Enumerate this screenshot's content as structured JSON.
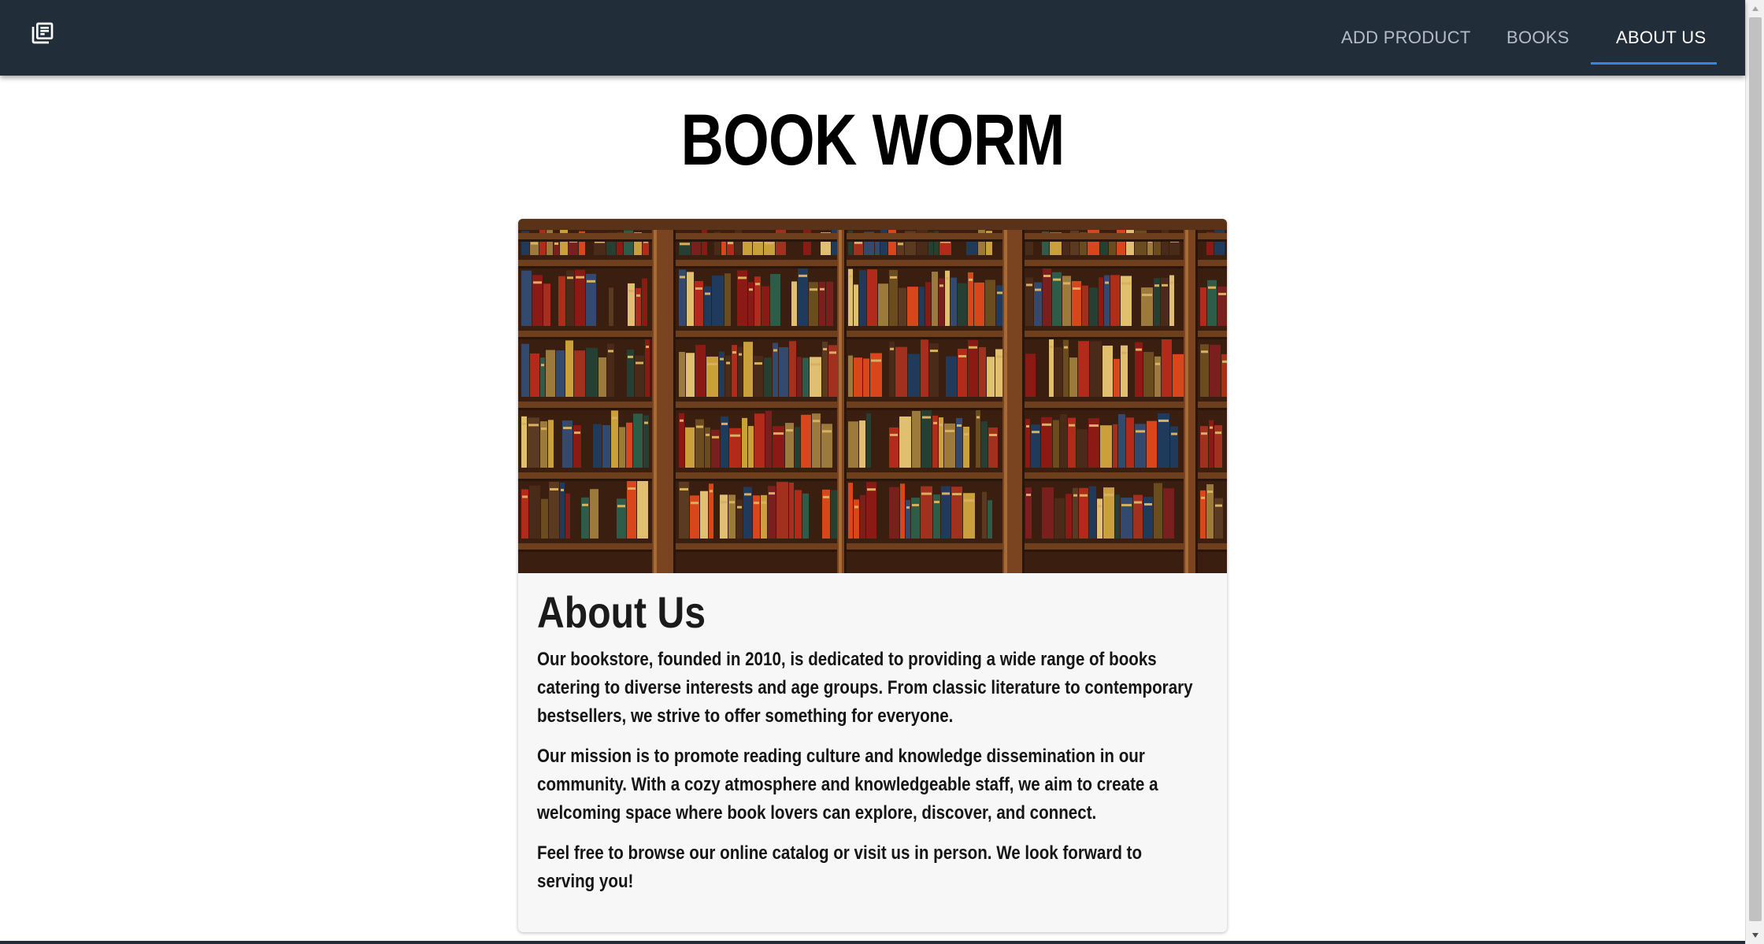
{
  "header": {
    "logo_icon": "library-books-icon",
    "nav": {
      "add_product": "ADD PRODUCT",
      "books": "BOOKS",
      "about_us": "ABOUT US"
    },
    "active_tab": "ABOUT US",
    "accent_color": "#2f86e8",
    "background_color": "#222d3a"
  },
  "page": {
    "title": "BOOK WORM"
  },
  "about_card": {
    "image": "bookshelves-photo",
    "heading": "About Us",
    "paragraphs": [
      "Our bookstore, founded in 2010, is dedicated to providing a wide range of books catering to diverse interests and age groups. From classic literature to contemporary bestsellers, we strive to offer something for everyone.",
      "Our mission is to promote reading culture and knowledge dissemination in our community. With a cozy atmosphere and knowledgeable staff, we aim to create a welcoming space where book lovers can explore, discover, and connect.",
      "Feel free to browse our online catalog or visit us in person. We look forward to serving you!"
    ]
  }
}
